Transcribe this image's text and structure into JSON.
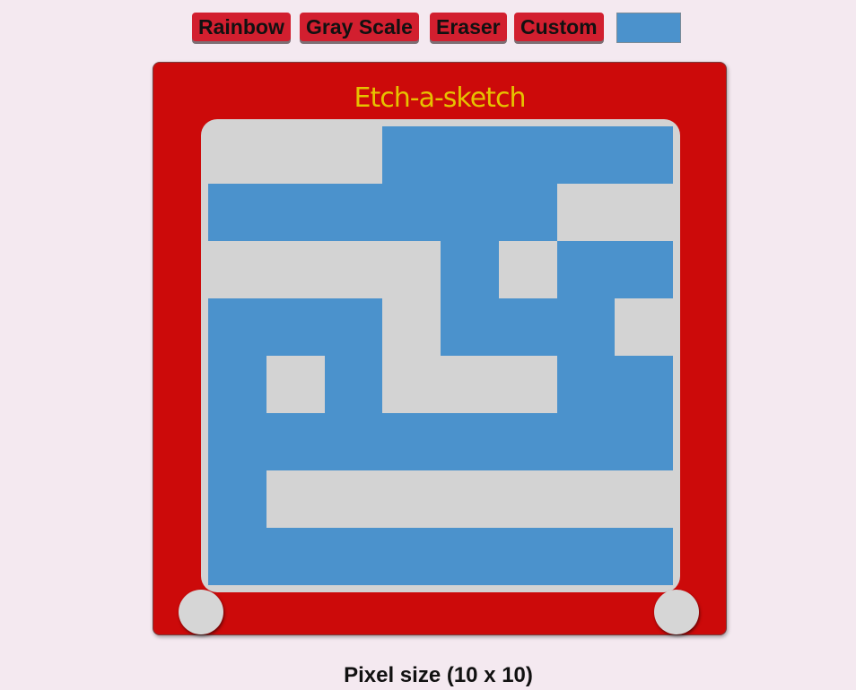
{
  "toolbar": {
    "rainbow_label": "Rainbow",
    "grayscale_label": "Gray Scale",
    "eraser_label": "Eraser",
    "custom_label": "Custom",
    "color_value": "#4b92cc"
  },
  "sketch": {
    "title": "Etch-a-sketch",
    "frame_color": "#cc0a0a",
    "on_color": "#4b92cc",
    "off_color": "#d3d3d3",
    "grid": [
      [
        0,
        0,
        0,
        1,
        1,
        1,
        1,
        1
      ],
      [
        1,
        1,
        1,
        1,
        1,
        1,
        0,
        0
      ],
      [
        0,
        0,
        0,
        0,
        1,
        0,
        1,
        1
      ],
      [
        1,
        1,
        1,
        0,
        1,
        1,
        1,
        0
      ],
      [
        1,
        0,
        1,
        0,
        0,
        0,
        1,
        1
      ],
      [
        1,
        1,
        1,
        1,
        1,
        1,
        1,
        1
      ],
      [
        1,
        0,
        0,
        0,
        0,
        0,
        0,
        0
      ],
      [
        1,
        1,
        1,
        1,
        1,
        1,
        1,
        1
      ]
    ]
  },
  "status": {
    "pixel_size": "Pixel size (10 x 10)"
  }
}
